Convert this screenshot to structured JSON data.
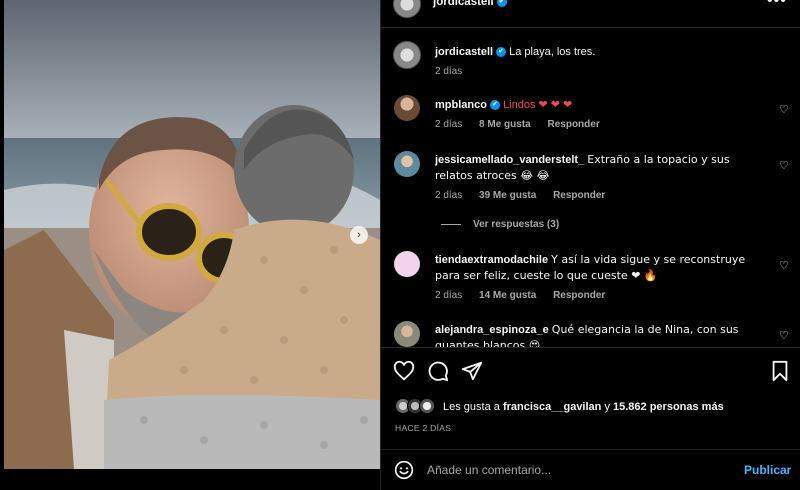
{
  "header": {
    "username": "jordicastell",
    "verified_mark": "✔"
  },
  "caption": {
    "username": "jordicastell",
    "text": "La playa, los tres.",
    "time": "2 días"
  },
  "comments": [
    {
      "username": "mpblanco",
      "verified": true,
      "text": "Lindos ❤ ❤ ❤",
      "time": "2 días",
      "likes": "8 Me gusta",
      "reply": "Responder"
    },
    {
      "username": "jessicamellado_vanderstelt_",
      "text": "Extraño a la topacio y sus relatos atroces 😂 😂",
      "time": "2 días",
      "likes": "39 Me gusta",
      "reply": "Responder",
      "view_replies": "Ver respuestas (3)"
    },
    {
      "username": "tiendaextramodachile",
      "text": "Y así la vida sigue y se reconstruye para ser feliz, cueste lo que cueste ❤ 🔥",
      "time": "2 días",
      "likes": "14 Me gusta",
      "reply": "Responder"
    },
    {
      "username": "alejandra_espinoza_e",
      "text": "Qué elegancia la de Nina, con sus guantes blancos 😍"
    }
  ],
  "likes": {
    "prefix": "Les gusta a",
    "user": "francisca__gavilan",
    "middle": "y",
    "others": "15.862 personas más"
  },
  "time_ago": "HACE 2 DÍAS",
  "add_comment": {
    "placeholder": "Añade un comentario...",
    "post_label": "Publicar"
  },
  "icons": {
    "emoji": "☺",
    "more": "•••",
    "next": "›",
    "heart": "♡"
  },
  "colors": {
    "accent": "#0095f6",
    "link": "#4cb5f9",
    "muted": "#a8a8a8"
  }
}
